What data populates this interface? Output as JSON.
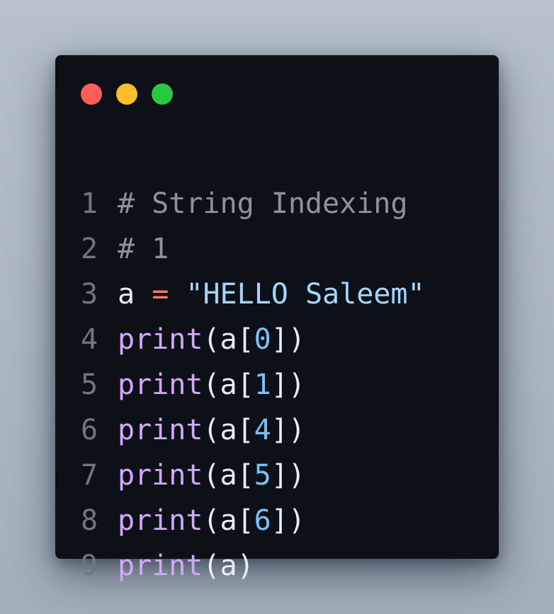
{
  "window": {
    "controls": [
      {
        "name": "close",
        "color": "#ff5f57"
      },
      {
        "name": "minimize",
        "color": "#febc2e"
      },
      {
        "name": "maximize",
        "color": "#28c840"
      }
    ]
  },
  "code": {
    "lines": [
      {
        "num": "1",
        "tokens": [
          {
            "t": "# String Indexing",
            "c": "comment"
          }
        ]
      },
      {
        "num": "2",
        "tokens": [
          {
            "t": "# 1",
            "c": "comment"
          }
        ]
      },
      {
        "num": "3",
        "tokens": [
          {
            "t": "a",
            "c": "ident"
          },
          {
            "t": " ",
            "c": "ident"
          },
          {
            "t": "=",
            "c": "op"
          },
          {
            "t": " ",
            "c": "ident"
          },
          {
            "t": "\"HELLO Saleem\"",
            "c": "str"
          }
        ]
      },
      {
        "num": "4",
        "tokens": [
          {
            "t": "print",
            "c": "kw"
          },
          {
            "t": "(a[",
            "c": "punc"
          },
          {
            "t": "0",
            "c": "num"
          },
          {
            "t": "])",
            "c": "punc"
          }
        ]
      },
      {
        "num": "5",
        "tokens": [
          {
            "t": "print",
            "c": "kw"
          },
          {
            "t": "(a[",
            "c": "punc"
          },
          {
            "t": "1",
            "c": "num"
          },
          {
            "t": "])",
            "c": "punc"
          }
        ]
      },
      {
        "num": "6",
        "tokens": [
          {
            "t": "print",
            "c": "kw"
          },
          {
            "t": "(a[",
            "c": "punc"
          },
          {
            "t": "4",
            "c": "num"
          },
          {
            "t": "])",
            "c": "punc"
          }
        ]
      },
      {
        "num": "7",
        "tokens": [
          {
            "t": "print",
            "c": "kw"
          },
          {
            "t": "(a[",
            "c": "punc"
          },
          {
            "t": "5",
            "c": "num"
          },
          {
            "t": "])",
            "c": "punc"
          }
        ]
      },
      {
        "num": "8",
        "tokens": [
          {
            "t": "print",
            "c": "kw"
          },
          {
            "t": "(a[",
            "c": "punc"
          },
          {
            "t": "6",
            "c": "num"
          },
          {
            "t": "])",
            "c": "punc"
          }
        ]
      },
      {
        "num": "9",
        "tokens": [
          {
            "t": "print",
            "c": "kw"
          },
          {
            "t": "(a)",
            "c": "punc"
          }
        ]
      }
    ]
  }
}
